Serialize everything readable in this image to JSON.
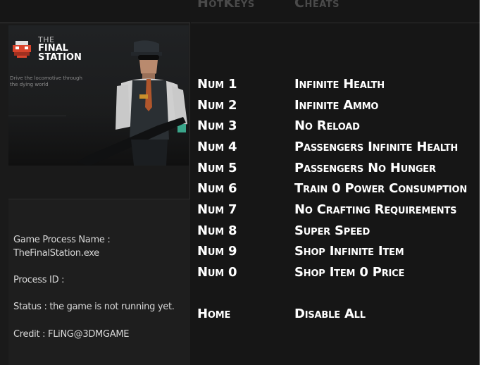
{
  "header": {
    "hotkeys_label": "HotKeys",
    "cheats_label": "Cheats"
  },
  "banner": {
    "logo_the": "THE",
    "logo_final": "FINAL",
    "logo_station": "STATION",
    "tagline": "Drive the locomotive through the dying world"
  },
  "info": {
    "process_name_label": "Game Process Name :",
    "process_name_value": "TheFinalStation.exe",
    "process_id": "Process ID :",
    "status": "Status : the game is not running yet.",
    "credit": "Credit : FLiNG@3DMGAME"
  },
  "cheats": [
    {
      "key": "Num 1",
      "cheat": "Infinite Health"
    },
    {
      "key": "Num 2",
      "cheat": "Infinite Ammo"
    },
    {
      "key": "Num 3",
      "cheat": "No Reload"
    },
    {
      "key": "Num 4",
      "cheat": "Passengers Infinite Health"
    },
    {
      "key": "Num 5",
      "cheat": "Passengers No Hunger"
    },
    {
      "key": "Num 6",
      "cheat": "Train 0 Power Consumption"
    },
    {
      "key": "Num 7",
      "cheat": "No Crafting Requirements"
    },
    {
      "key": "Num 8",
      "cheat": "Super Speed"
    },
    {
      "key": "Num 9",
      "cheat": "Shop Infinite Item"
    },
    {
      "key": "Num 0",
      "cheat": "Shop Item 0 Price"
    }
  ],
  "disable": {
    "key": "Home",
    "cheat": "Disable All"
  },
  "colors": {
    "background": "#161616",
    "text": "#ffffff",
    "header_text": "#4a4a4a",
    "logo_accent": "#d8442c"
  }
}
